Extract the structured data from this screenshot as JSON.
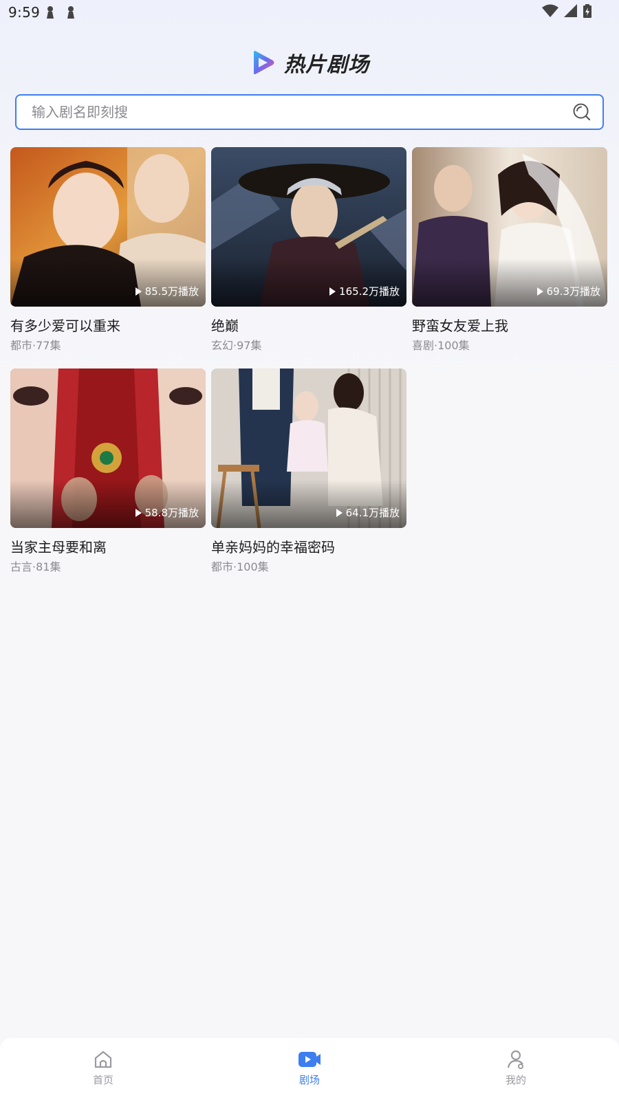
{
  "status_bar": {
    "time": "9:59",
    "left_icons": [
      "notification-icon",
      "notification-icon"
    ],
    "right_icons": [
      "wifi-icon",
      "signal-icon",
      "battery-icon"
    ]
  },
  "header": {
    "title": "热片剧场",
    "logo_icon": "play-logo-icon"
  },
  "search": {
    "placeholder": "输入剧名即刻搜",
    "value": "",
    "icon": "search-icon"
  },
  "dramas": [
    {
      "title": "有多少爱可以重来",
      "genre_episodes": "都市·77集",
      "plays": "85.5万播放"
    },
    {
      "title": "绝巅",
      "genre_episodes": "玄幻·97集",
      "plays": "165.2万播放"
    },
    {
      "title": "野蛮女友爱上我",
      "genre_episodes": "喜剧·100集",
      "plays": "69.3万播放"
    },
    {
      "title": "当家主母要和离",
      "genre_episodes": "古言·81集",
      "plays": "58.8万播放"
    },
    {
      "title": "单亲妈妈的幸福密码",
      "genre_episodes": "都市·100集",
      "plays": "64.1万播放"
    }
  ],
  "bottom_nav": {
    "items": [
      {
        "label": "首页",
        "icon": "home-icon",
        "active": false
      },
      {
        "label": "剧场",
        "icon": "video-icon",
        "active": true
      },
      {
        "label": "我的",
        "icon": "profile-icon",
        "active": false
      }
    ],
    "active_color": "#3d7ef0",
    "inactive_color": "#9a9aa0"
  },
  "colors": {
    "accent": "#3d7ef0"
  }
}
